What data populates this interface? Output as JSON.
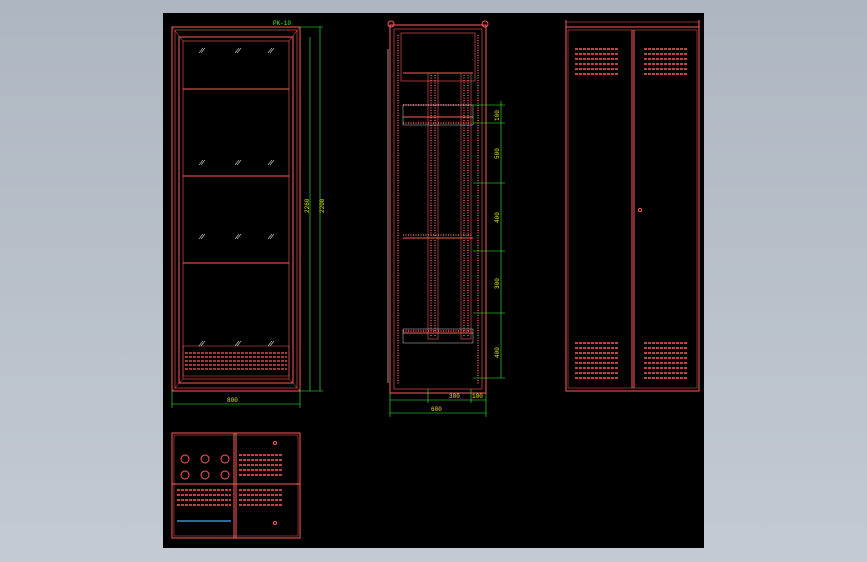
{
  "colors": {
    "background": "#000000",
    "outline": "#ff5a5a",
    "dimension": "#33ff33",
    "text": "#e8e800",
    "detail": "#ffffff"
  },
  "front_view": {
    "label": "PK-10",
    "width_dim": "800",
    "height_dim_outer": "2260",
    "height_dim_inner": "2200"
  },
  "side_view": {
    "dims_vertical": [
      "100",
      "500",
      "400",
      "300",
      "400"
    ],
    "dims_horizontal": [
      "300",
      "100"
    ],
    "width_dim": "600"
  },
  "rear_view": {},
  "plan_view": {}
}
